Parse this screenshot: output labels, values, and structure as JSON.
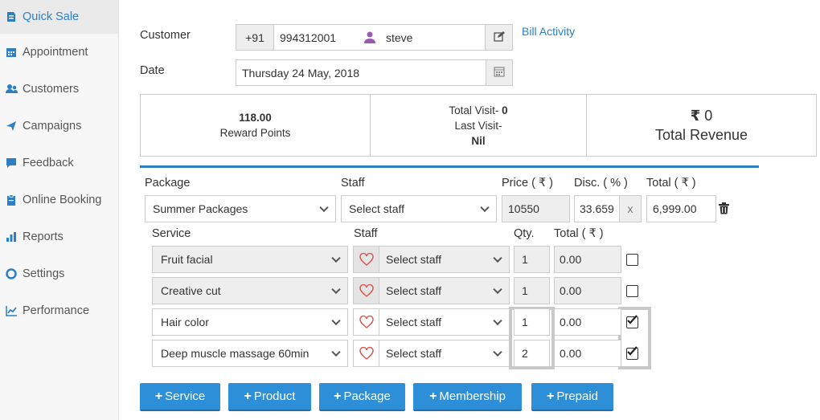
{
  "sidebar": {
    "items": [
      {
        "label": "Quick Sale",
        "icon": "quick-sale-icon",
        "active": true
      },
      {
        "label": "Appointment",
        "icon": "calendar-icon"
      },
      {
        "label": "Customers",
        "icon": "users-icon"
      },
      {
        "label": "Campaigns",
        "icon": "paper-plane-icon"
      },
      {
        "label": "Feedback",
        "icon": "comment-icon"
      },
      {
        "label": "Online Booking",
        "icon": "clipboard-icon"
      },
      {
        "label": "Reports",
        "icon": "bar-chart-icon"
      },
      {
        "label": "Settings",
        "icon": "lifebuoy-icon"
      },
      {
        "label": "Performance",
        "icon": "line-chart-icon"
      }
    ]
  },
  "customer": {
    "label": "Customer",
    "country_code": "+91",
    "phone": "994312001",
    "name": "steve",
    "bill_activity": "Bill Activity"
  },
  "date": {
    "label": "Date",
    "value": "Thursday 24 May, 2018"
  },
  "stats": {
    "reward_points": "118.00",
    "reward_label": "Reward Points",
    "total_visit": "Total Visit- ",
    "total_visit_value": "0",
    "last_visit": "Last Visit-",
    "last_visit_value": "Nil",
    "revenue_currency": "₹",
    "revenue_value": "0",
    "revenue_label": "Total Revenue"
  },
  "package": {
    "headers": {
      "package": "Package",
      "staff": "Staff",
      "price": "Price ( ₹ )",
      "disc": "Disc. ( % )",
      "total": "Total ( ₹ )"
    },
    "name": "Summer Packages",
    "staff": "Select staff",
    "price": "10550",
    "disc": "33.659",
    "disc_clear": "x",
    "total": "6,999.00"
  },
  "services": {
    "headers": {
      "service": "Service",
      "staff": "Staff",
      "qty": "Qty.",
      "total": "Total ( ₹ )"
    },
    "rows": [
      {
        "name": "Fruit facial",
        "staff": "Select staff",
        "qty": "1",
        "total": "0.00",
        "checked": false,
        "disabled": true
      },
      {
        "name": "Creative cut",
        "staff": "Select staff",
        "qty": "1",
        "total": "0.00",
        "checked": false,
        "disabled": true
      },
      {
        "name": "Hair color",
        "staff": "Select staff",
        "qty": "1",
        "total": "0.00",
        "checked": true,
        "disabled": false
      },
      {
        "name": "Deep muscle massage 60min",
        "staff": "Select staff",
        "qty": "2",
        "total": "0.00",
        "checked": true,
        "disabled": false
      }
    ]
  },
  "actions": {
    "service": "Service",
    "product": "Product",
    "package": "Package",
    "membership": "Membership",
    "prepaid": "Prepaid",
    "plus": "+"
  },
  "colors": {
    "accent": "#2d8fd8",
    "link": "#2d7fc4",
    "heart": "#d9534f",
    "avatar": "#9b59b6"
  }
}
